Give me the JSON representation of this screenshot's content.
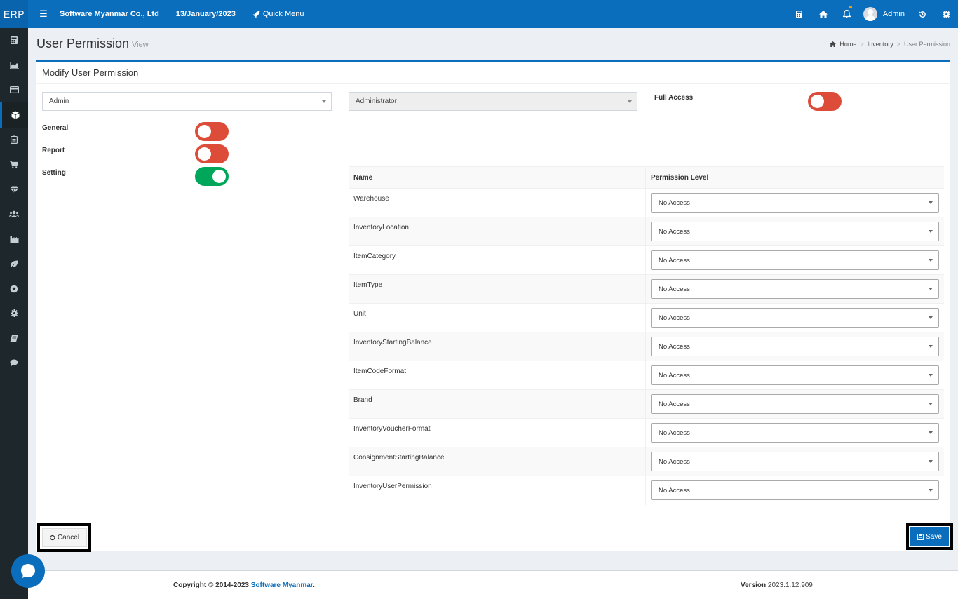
{
  "topbar": {
    "brand": "ERP",
    "company": "Software Myanmar Co., Ltd",
    "date": "13/January/2023",
    "quick_menu": "Quick Menu",
    "user_name": "Admin",
    "icons": [
      "menu-icon",
      "rocket-icon",
      "calculator-icon",
      "home-icon",
      "bell-icon",
      "history-icon",
      "gear-icon"
    ],
    "notification_color": "#f39c12"
  },
  "sidebar": {
    "items": [
      "calculator-icon",
      "area-chart-icon",
      "credit-card-icon",
      "cube-icon",
      "clipboard-icon",
      "cart-icon",
      "diamond-icon",
      "users-icon",
      "industry-icon",
      "leaf-icon",
      "soccer-ball-icon",
      "gear-icon",
      "book-icon",
      "comment-icon"
    ],
    "active_index": 3
  },
  "header": {
    "title": "User Permission",
    "subtitle": "View",
    "breadcrumb": [
      "Home",
      "Inventory",
      "User Permission"
    ]
  },
  "form": {
    "box_title": "Modify User Permission",
    "user_select": "Admin",
    "role_select": "Administrator",
    "full_access_label": "Full Access",
    "full_access_on": false,
    "modules": [
      {
        "label": "General",
        "on": false
      },
      {
        "label": "Report",
        "on": false
      },
      {
        "label": "Setting",
        "on": true
      }
    ]
  },
  "table": {
    "headers": [
      "Name",
      "Permission Level"
    ],
    "rows": [
      {
        "name": "Warehouse",
        "level": "No Access"
      },
      {
        "name": "InventoryLocation",
        "level": "No Access"
      },
      {
        "name": "ItemCategory",
        "level": "No Access"
      },
      {
        "name": "ItemType",
        "level": "No Access"
      },
      {
        "name": "Unit",
        "level": "No Access"
      },
      {
        "name": "InventoryStartingBalance",
        "level": "No Access"
      },
      {
        "name": "ItemCodeFormat",
        "level": "No Access"
      },
      {
        "name": "Brand",
        "level": "No Access"
      },
      {
        "name": "InventoryVoucherFormat",
        "level": "No Access"
      },
      {
        "name": "ConsignmentStartingBalance",
        "level": "No Access"
      },
      {
        "name": "InventoryUserPermission",
        "level": "No Access"
      }
    ]
  },
  "actions": {
    "cancel": "Cancel",
    "save": "Save"
  },
  "footer": {
    "copyright_prefix": "Copyright © 2014-2023",
    "company_link": "Software Myanmar",
    "period": ".",
    "version_label": "Version",
    "version": "2023.1.12.909"
  },
  "colors": {
    "primary": "#0a6ebd",
    "toggle_off": "#dd4b39",
    "toggle_on": "#00a65a",
    "sidebar": "#1e282c"
  }
}
